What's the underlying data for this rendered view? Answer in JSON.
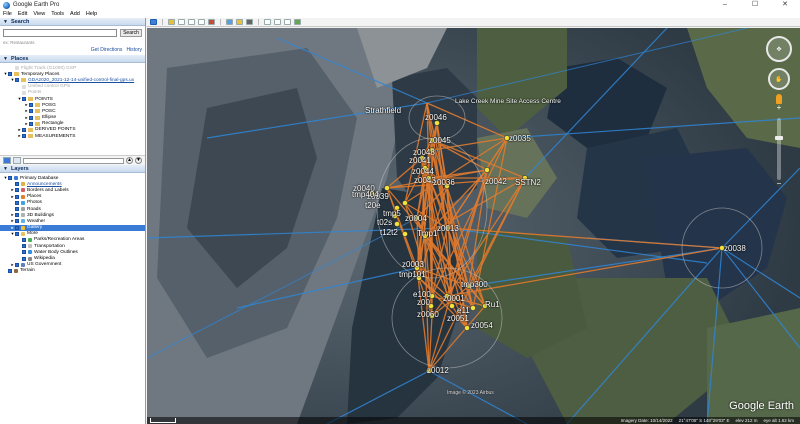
{
  "window": {
    "title": "Google Earth Pro",
    "controls": [
      "–",
      "☐",
      "✕"
    ]
  },
  "menu": [
    "File",
    "Edit",
    "View",
    "Tools",
    "Add",
    "Help"
  ],
  "search": {
    "header": "Search",
    "placeholder": "",
    "button": "Search",
    "hint": "ex: Restaurants",
    "get_directions": "Get Directions",
    "history": "History"
  },
  "places": {
    "header": "Places",
    "items": [
      {
        "label": "Flight Track (G1000) GSP",
        "indent": 1,
        "faded": true
      },
      {
        "label": "Temporary Places",
        "indent": 0,
        "checked": true,
        "folder": true,
        "expand": "▾"
      },
      {
        "label": "GDA2020_2021-12-14-unified-control-final-gps.ux",
        "indent": 1,
        "checked": true,
        "folder": true,
        "link": true,
        "expand": "▾"
      },
      {
        "label": "Unified control GPS",
        "indent": 2,
        "faded": true
      },
      {
        "label": "Points",
        "indent": 2,
        "faded": true
      },
      {
        "label": "POINTS",
        "indent": 2,
        "checked": true,
        "folder": true,
        "expand": "▾"
      },
      {
        "label": "POSG",
        "indent": 3,
        "checked": true,
        "folder": true,
        "expand": "▸"
      },
      {
        "label": "POSC",
        "indent": 3,
        "checked": true,
        "folder": true,
        "expand": "▸"
      },
      {
        "label": "Ellipse",
        "indent": 3,
        "checked": true,
        "folder": true,
        "expand": "▸"
      },
      {
        "label": "Rectangle",
        "indent": 3,
        "checked": true,
        "folder": true,
        "expand": "▸"
      },
      {
        "label": "DERIVED POINTS",
        "indent": 2,
        "checked": true,
        "folder": true,
        "expand": "▸"
      },
      {
        "label": "MEASUREMENTS",
        "indent": 2,
        "checked": true,
        "folder": true,
        "expand": "▸"
      }
    ]
  },
  "layers": {
    "header": "Layers",
    "items": [
      {
        "label": "Primary Database",
        "indent": 0,
        "checked": true,
        "expand": "▾",
        "color": "#3a7bd5"
      },
      {
        "label": "Announcements",
        "indent": 1,
        "checked": true,
        "color": "#e0b040",
        "link": true
      },
      {
        "label": "Borders and Labels",
        "indent": 1,
        "checked": true,
        "color": "#d06060",
        "expand": "▸"
      },
      {
        "label": "Places",
        "indent": 1,
        "checked": true,
        "color": "#e08030",
        "expand": "▸"
      },
      {
        "label": "Photos",
        "indent": 1,
        "checked": true,
        "color": "#40a0e0"
      },
      {
        "label": "Roads",
        "indent": 1,
        "checked": true,
        "color": "#a0a0a0"
      },
      {
        "label": "3D Buildings",
        "indent": 1,
        "checked": true,
        "color": "#b0b0b0",
        "expand": "▸"
      },
      {
        "label": "Weather",
        "indent": 1,
        "checked": true,
        "color": "#60b0e0",
        "expand": "▸"
      },
      {
        "label": "Gallery",
        "indent": 1,
        "checked": true,
        "color": "#f0c030",
        "expand": "▸",
        "selected": true
      },
      {
        "label": "More",
        "indent": 1,
        "checked": true,
        "color": "#e8c060",
        "expand": "▾"
      },
      {
        "label": "Parks/Recreation Areas",
        "indent": 2,
        "checked": true,
        "color": "#4caf50"
      },
      {
        "label": "Transportation",
        "indent": 2,
        "checked": true,
        "color": "#c0c0c0"
      },
      {
        "label": "Water Body Outlines",
        "indent": 2,
        "checked": true,
        "color": "#3090e0"
      },
      {
        "label": "Wikipedia",
        "indent": 2,
        "checked": true,
        "color": "#888888"
      },
      {
        "label": "US Government",
        "indent": 1,
        "checked": true,
        "color": "#6080c0",
        "expand": "▸"
      },
      {
        "label": "Terrain",
        "indent": 0,
        "checked": true,
        "color": "#8a6a40"
      }
    ]
  },
  "map": {
    "labels": [
      "z0046",
      "z0045",
      "z0048",
      "z0041",
      "z0044",
      "z0043",
      "z0035",
      "z0042",
      "z0036",
      "z0040",
      "z0039",
      "SSTN2",
      "tmp404",
      "t20e",
      "tmp5",
      "t02s",
      "t12t2",
      "z0004",
      "Tmp1",
      "z0013",
      "z0038",
      "z0003",
      "tmp101",
      "tmp300",
      "e100",
      "z00",
      "z0060",
      "z0051",
      "z0001",
      "e11",
      "Ru1",
      "z0054",
      "z0012",
      "Strathfield",
      "Lake Creek Mine Site Access Centre"
    ],
    "copyright": "Image © 2023 Airbus",
    "logo": "Google Earth",
    "status": {
      "imagery_date": "Imagery Date: 10/14/2022",
      "coords": "21°47'05\" S 148°29'03\" E",
      "elev": "elev  212 m",
      "eye_alt": "eye alt  1.62 km"
    },
    "scale": "",
    "colors": {
      "orange_line": "#e07a2e",
      "blue_line": "#2f86d6",
      "pin": "#f4e13a"
    }
  }
}
